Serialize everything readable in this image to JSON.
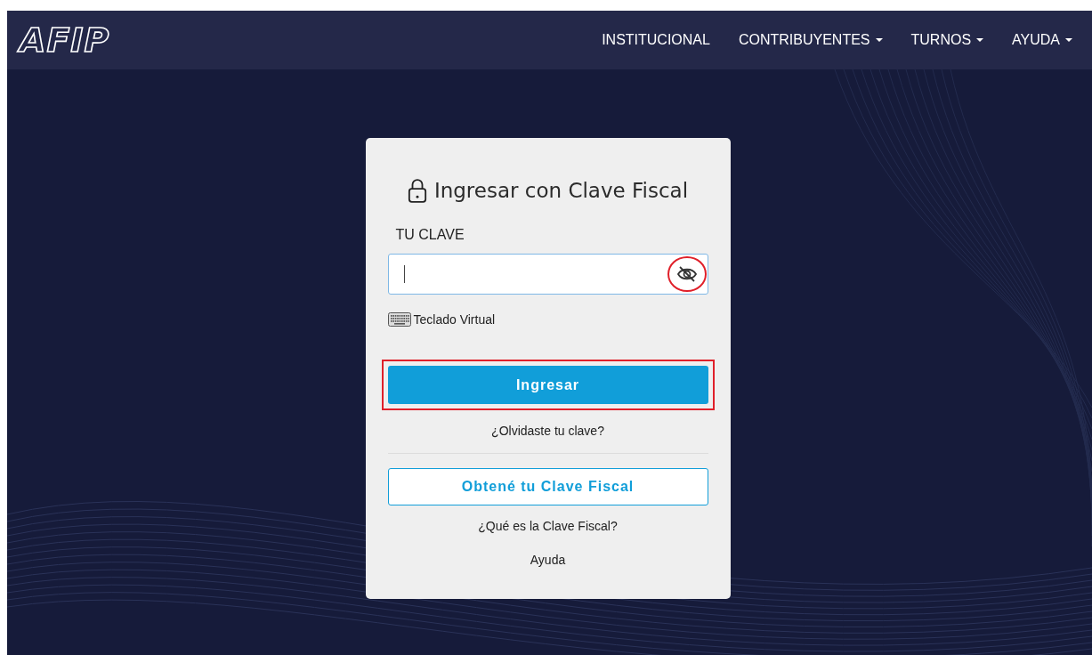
{
  "header": {
    "logo": "AFIP",
    "menu": [
      {
        "label": "INSTITUCIONAL",
        "has_dropdown": false
      },
      {
        "label": "CONTRIBUYENTES",
        "has_dropdown": true
      },
      {
        "label": "TURNOS",
        "has_dropdown": true
      },
      {
        "label": "AYUDA",
        "has_dropdown": true
      }
    ]
  },
  "login": {
    "title": "Ingresar con Clave Fiscal",
    "field_label": "TU CLAVE",
    "password": {
      "focused": true,
      "toggle_highlighted": true
    },
    "virtual_keyboard": "Teclado Virtual",
    "submit": {
      "label": "Ingresar",
      "highlighted": true
    },
    "forgot_link": "¿Olvidaste tu clave?",
    "get_key_button": "Obtené tu Clave Fiscal",
    "what_is_link": "¿Qué es la Clave Fiscal?",
    "help_link": "Ayuda"
  }
}
